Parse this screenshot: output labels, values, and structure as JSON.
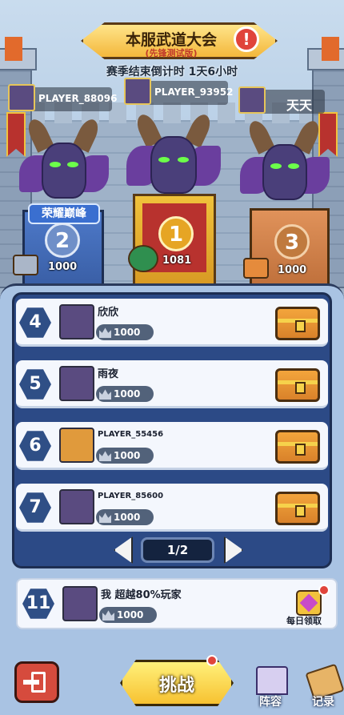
{
  "header": {
    "title": "本服武道大会",
    "subtitle": "(先锋测试版)",
    "alert_icon": "!",
    "season": "赛季结束倒计时 1天6小时"
  },
  "top_players": [
    {
      "name": "PLAYER_88096"
    },
    {
      "name": "PLAYER_93952"
    },
    {
      "name": "天天"
    }
  ],
  "podium": {
    "honor_badge": "荣耀巅峰",
    "second": {
      "rank": "2",
      "score": "1000"
    },
    "first": {
      "rank": "1",
      "score": "1081"
    },
    "third": {
      "rank": "3",
      "score": "1000"
    }
  },
  "rows": [
    {
      "rank": "4",
      "name": "欣欣",
      "score": "1000"
    },
    {
      "rank": "5",
      "name": "雨夜",
      "score": "1000"
    },
    {
      "rank": "6",
      "name": "PLAYER_55456",
      "score": "1000"
    },
    {
      "rank": "7",
      "name": "PLAYER_85600",
      "score": "1000"
    }
  ],
  "pager": {
    "label": "1/2"
  },
  "me": {
    "rank": "11",
    "name": "我   超越80%玩家",
    "score": "1000",
    "daily_label": "每日领取"
  },
  "bottom": {
    "challenge": "挑战",
    "lineup": "阵容",
    "records": "记录"
  },
  "colors": {
    "accent": "#f7c231",
    "panel": "#2c4a86",
    "alert": "#e0443b"
  }
}
